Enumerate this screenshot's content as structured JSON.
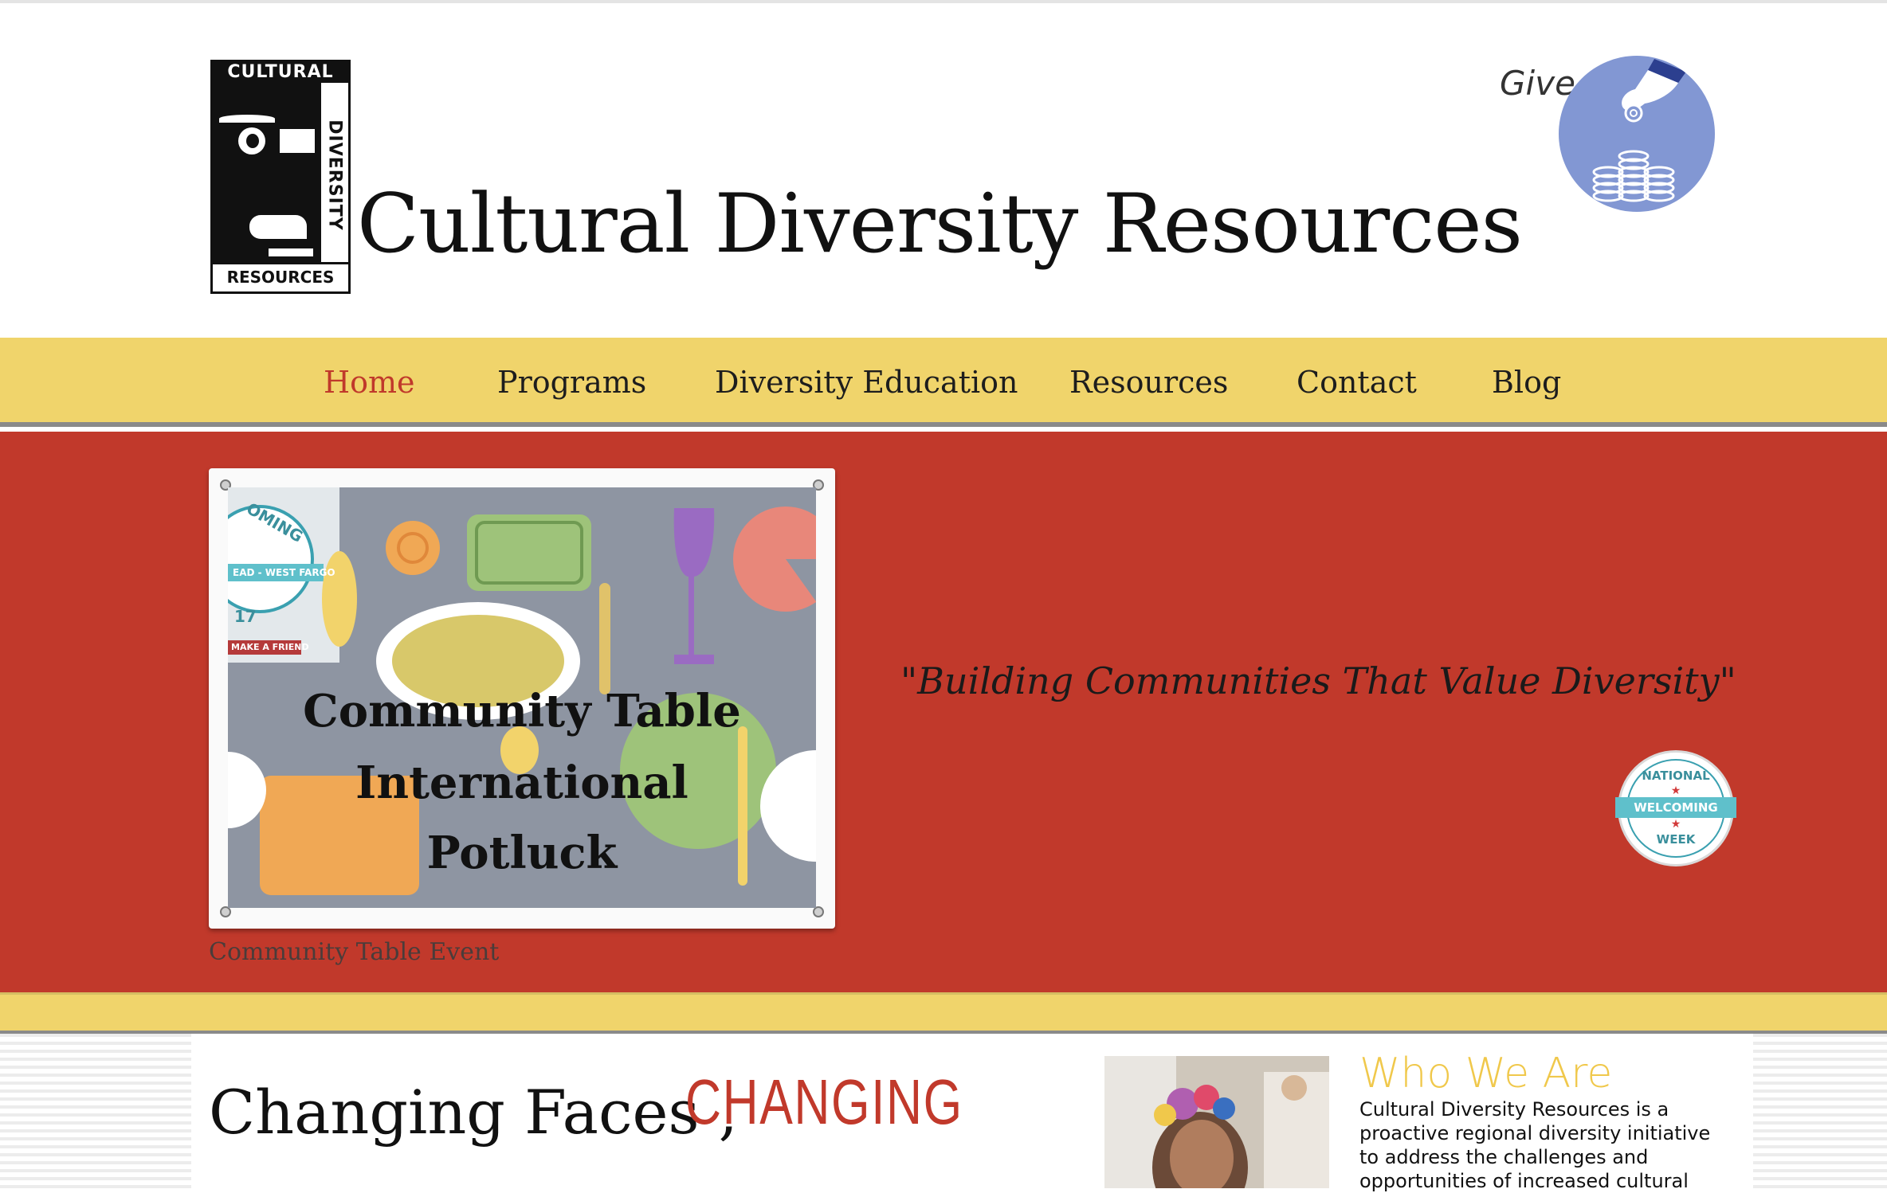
{
  "header": {
    "logo": {
      "top_text": "CULTURAL",
      "side_text": "DIVERSITY",
      "bottom_text": "RESOURCES"
    },
    "site_title": "Cultural Diversity Resources",
    "give_label": "Give"
  },
  "nav": {
    "items": [
      {
        "label": "Home",
        "active": true
      },
      {
        "label": "Programs",
        "active": false
      },
      {
        "label": "Diversity Education",
        "active": false
      },
      {
        "label": "Resources",
        "active": false
      },
      {
        "label": "Contact",
        "active": false
      },
      {
        "label": "Blog",
        "active": false
      }
    ]
  },
  "hero": {
    "slide": {
      "lines": [
        "Community Table",
        "International",
        "Potluck"
      ],
      "badge_text": "OMING",
      "badge_sub": "EAD - WEST FARGO",
      "badge_year": "17",
      "badge_ribbon": "MAKE A FRIEND"
    },
    "caption": "Community Table Event",
    "tagline": "\"Building Communities That Value Diversity\"",
    "badge": {
      "top": "NATIONAL",
      "band": "WELCOMING",
      "bottom": "WEEK"
    }
  },
  "lower": {
    "heading_a": "Changing Faces ,",
    "heading_b": "Changing",
    "who_title": "Who We Are",
    "who_text": "Cultural Diversity Resources is a proactive regional diversity initiative to address the challenges and opportunities of increased cultural"
  },
  "colors": {
    "accent_red": "#c1392b",
    "nav_yellow": "#f0d46b",
    "give_blue": "#8297d3",
    "who_gold": "#f0c84b"
  }
}
